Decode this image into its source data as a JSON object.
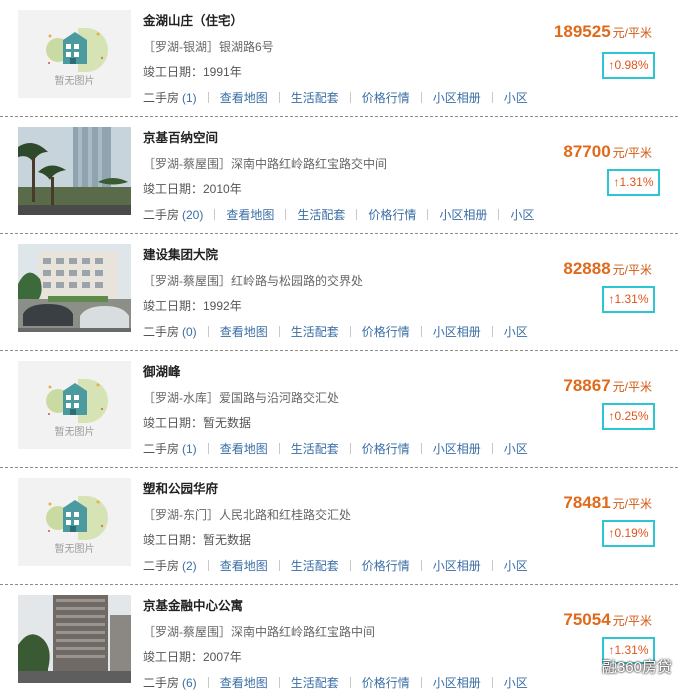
{
  "listings": [
    {
      "name": "金湖山庄（住宅）",
      "address": "［罗湖-银湖］银湖路6号",
      "completed": "竣工日期：1991年",
      "price": "189525",
      "price_unit": "元/平米",
      "change": "↑0.98%",
      "no_image": true,
      "no_image_text": "暂无图片",
      "secondhand_label": "二手房",
      "secondhand_count": "(1)",
      "photo": "none"
    },
    {
      "name": "京基百纳空间",
      "address": "［罗湖-蔡屋围］深南中路红岭路红宝路交中间",
      "completed": "竣工日期：2010年",
      "price": "87700",
      "price_unit": "元/平米",
      "change": "↑1.31%",
      "no_image": false,
      "secondhand_label": "二手房",
      "secondhand_count": "(20)",
      "photo": "palms-tower"
    },
    {
      "name": "建设集团大院",
      "address": "［罗湖-蔡屋围］红岭路与松园路的交界处",
      "completed": "竣工日期：1992年",
      "price": "82888",
      "price_unit": "元/平米",
      "change": "↑1.31%",
      "no_image": false,
      "secondhand_label": "二手房",
      "secondhand_count": "(0)",
      "photo": "courtyard-cars"
    },
    {
      "name": "御湖峰",
      "address": "［罗湖-水库］爱国路与沿河路交汇处",
      "completed": "竣工日期：暂无数据",
      "price": "78867",
      "price_unit": "元/平米",
      "change": "↑0.25%",
      "no_image": true,
      "no_image_text": "暂无图片",
      "secondhand_label": "二手房",
      "secondhand_count": "(1)",
      "photo": "none"
    },
    {
      "name": "塑和公园华府",
      "address": "［罗湖-东门］人民北路和红桂路交汇处",
      "completed": "竣工日期：暂无数据",
      "price": "78481",
      "price_unit": "元/平米",
      "change": "↑0.19%",
      "no_image": true,
      "no_image_text": "暂无图片",
      "secondhand_label": "二手房",
      "secondhand_count": "(2)",
      "photo": "none"
    },
    {
      "name": "京基金融中心公寓",
      "address": "［罗湖-蔡屋围］深南中路红岭路红宝路中间",
      "completed": "竣工日期：2007年",
      "price": "75054",
      "price_unit": "元/平米",
      "change": "↑1.31%",
      "no_image": false,
      "secondhand_label": "二手房",
      "secondhand_count": "(6)",
      "photo": "highrise"
    }
  ],
  "links": {
    "map": "查看地图",
    "amenities": "生活配套",
    "price_trend": "价格行情",
    "album": "小区相册",
    "more": "小区"
  },
  "watermark": "融360房贷",
  "colors": {
    "price": "#e06a1b",
    "change_border": "#2ec5d3",
    "link": "#3a6ea5"
  }
}
